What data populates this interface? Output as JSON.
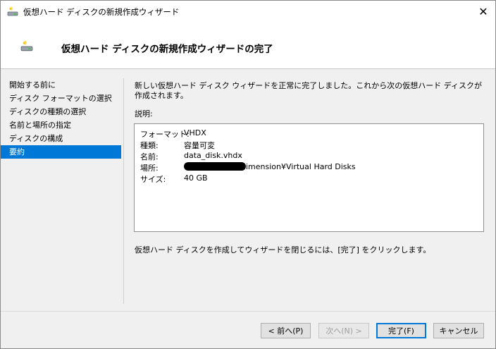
{
  "window": {
    "title": "仮想ハード ディスクの新規作成ウィザード",
    "close_glyph": "✕"
  },
  "header": {
    "title": "仮想ハード ディスクの新規作成ウィザードの完了"
  },
  "sidebar": {
    "items": [
      {
        "label": "開始する前に"
      },
      {
        "label": "ディスク フォーマットの選択"
      },
      {
        "label": "ディスクの種類の選択"
      },
      {
        "label": "名前と場所の指定"
      },
      {
        "label": "ディスクの構成"
      },
      {
        "label": "要約",
        "selected": true
      }
    ]
  },
  "main": {
    "intro": "新しい仮想ハード ディスク ウィザードを正常に完了しました。これから次の仮想ハード ディスクが作成されます。",
    "description_label": "説明:",
    "summary": [
      {
        "key": "フォーマット:",
        "value": "VHDX"
      },
      {
        "key": "種類:",
        "value": "容量可変"
      },
      {
        "key": "名前:",
        "value": "data_disk.vhdx"
      },
      {
        "key": "場所:",
        "value": "imension¥Virtual Hard Disks",
        "redacted_prefix": true
      },
      {
        "key": "サイズ:",
        "value": "40 GB"
      }
    ],
    "footer_note": "仮想ハード ディスクを作成してウィザードを閉じるには、[完了] をクリックします。"
  },
  "buttons": {
    "back": "< 前へ(P)",
    "next": "次へ(N) >",
    "finish": "完了(F)",
    "cancel": "キャンセル"
  }
}
